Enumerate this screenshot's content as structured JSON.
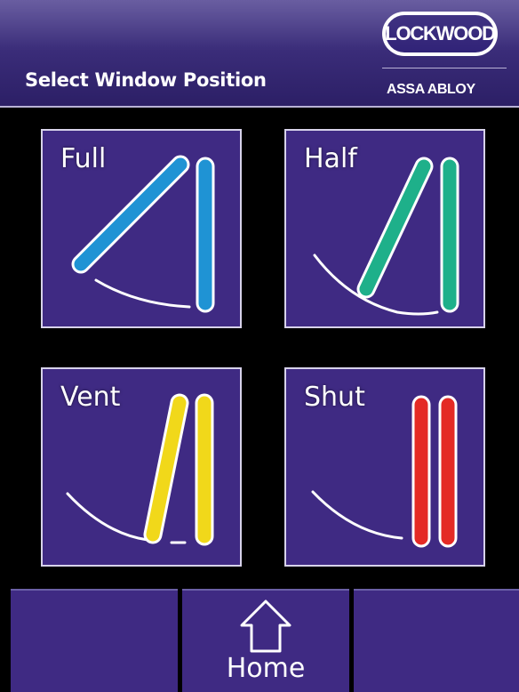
{
  "header": {
    "title": "Select Window Position",
    "logo_text": "LOCKWOOD",
    "brand": "ASSA ABLOY"
  },
  "positions": [
    {
      "label": "Full",
      "color": "#1f93d4"
    },
    {
      "label": "Half",
      "color": "#1eb08a"
    },
    {
      "label": "Vent",
      "color": "#f1d81a"
    },
    {
      "label": "Shut",
      "color": "#e42a25"
    }
  ],
  "footer": {
    "home_label": "Home",
    "home_icon": "home-icon"
  }
}
